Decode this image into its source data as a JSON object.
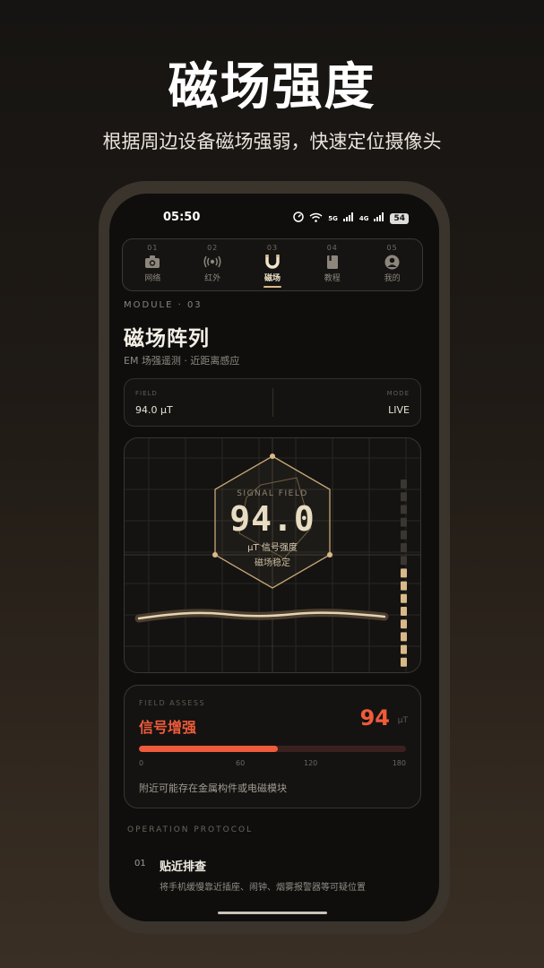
{
  "promo": {
    "title": "磁场强度",
    "subtitle": "根据周边设备磁场强弱，快速定位摄像头"
  },
  "status_bar": {
    "time": "05:50",
    "network1": "5G",
    "network2": "4G",
    "battery": "54"
  },
  "tabs": [
    {
      "num": "01",
      "label": "网络",
      "icon": "camera-icon"
    },
    {
      "num": "02",
      "label": "红外",
      "icon": "infrared-icon"
    },
    {
      "num": "03",
      "label": "磁场",
      "icon": "magnet-icon",
      "active": true
    },
    {
      "num": "04",
      "label": "教程",
      "icon": "book-icon"
    },
    {
      "num": "05",
      "label": "我的",
      "icon": "user-icon"
    }
  ],
  "module": {
    "label": "MODULE · 03",
    "title": "磁场阵列",
    "subtitle": "EM 场强遥测 · 近距离感应"
  },
  "field_card": {
    "field_label": "FIELD",
    "field_value": "94.0 μT",
    "mode_label": "MODE",
    "mode_value": "LIVE"
  },
  "signal": {
    "label": "SIGNAL FIELD",
    "value": "94.0",
    "unit_text": "μT 信号强度",
    "status": "磁场稳定",
    "level_bars_total": 15,
    "level_bars_lit": 8
  },
  "assess": {
    "label": "FIELD ASSESS",
    "title": "信号增强",
    "value": "94",
    "unit": "μT",
    "bar_fraction": 0.52,
    "ticks": [
      "0",
      "60",
      "120",
      "180"
    ],
    "note": "附近可能存在金属构件或电磁模块"
  },
  "protocol": {
    "label": "OPERATION PROTOCOL",
    "steps": [
      {
        "num": "01",
        "title": "贴近排查",
        "desc": "将手机缓慢靠近插座、闹钟、烟雾报警器等可疑位置"
      }
    ]
  },
  "colors": {
    "accent": "#ef5b3b",
    "gold": "#d9b98a",
    "background": "#0f0e0d"
  }
}
